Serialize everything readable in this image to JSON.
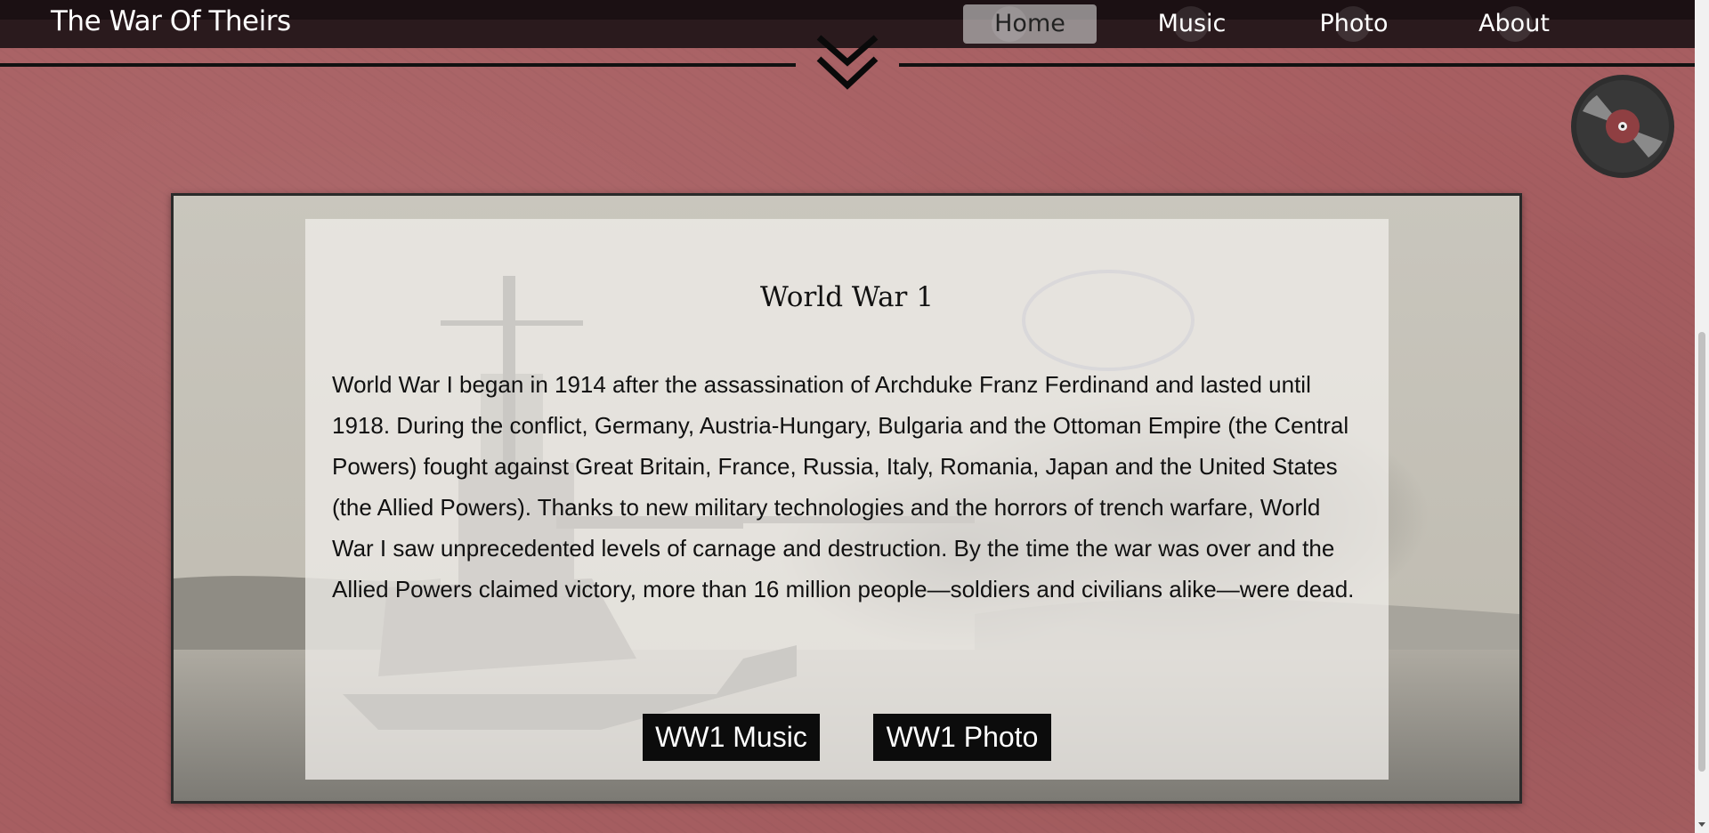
{
  "navbar": {
    "brand": "The War Of Theirs",
    "items": [
      {
        "label": "Home",
        "active": true
      },
      {
        "label": "Music",
        "active": false
      },
      {
        "label": "Photo",
        "active": false
      },
      {
        "label": "About",
        "active": false
      }
    ]
  },
  "scroll_icon": "double-chevron-down-icon",
  "music_player_icon": "vinyl-record-icon",
  "card": {
    "title": "World War 1",
    "body": "World War I began in 1914 after the assassination of Archduke Franz Ferdinand and lasted until 1918. During the conflict, Germany, Austria-Hungary, Bulgaria and the Ottoman Empire (the Central Powers) fought against Great Britain, France, Russia, Italy, Romania, Japan and the United States (the Allied Powers). Thanks to new military technologies and the horrors of trench warfare, World War I saw unprecedented levels of carnage and destruction. By the time the war was over and the Allied Powers claimed victory, more than 16 million people—soldiers and civilians alike—were dead.",
    "buttons": {
      "music": "WW1 Music",
      "photo": "WW1 Photo"
    }
  },
  "colors": {
    "page_background": "#a75e61",
    "navbar": "#1b1013",
    "button": "#0c0c0c"
  }
}
